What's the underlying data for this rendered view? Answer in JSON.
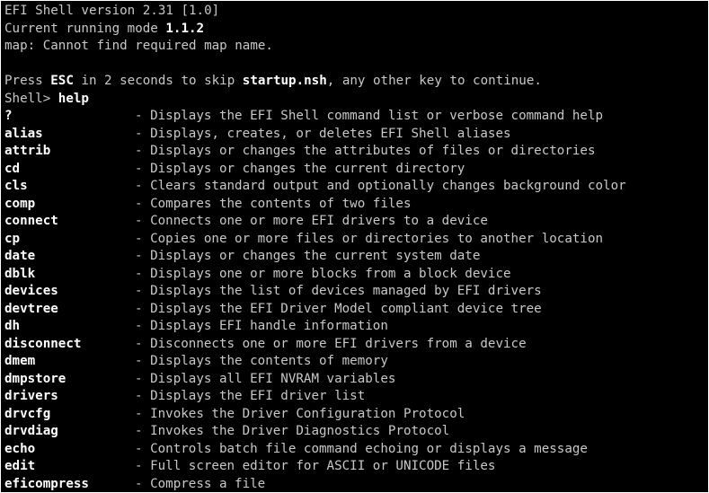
{
  "header": {
    "version_line": "EFI Shell version 2.31 [1.0]",
    "mode_prefix": "Current running mode ",
    "mode_value": "1.1.2",
    "map_line": "map: Cannot find required map name."
  },
  "startup": {
    "press": "Press ",
    "key": "ESC",
    "middle": " in 2 seconds to skip ",
    "file": "startup.nsh",
    "end": ", any other key to continue."
  },
  "prompt": {
    "label": "Shell> ",
    "command": "help"
  },
  "commands": [
    {
      "name": "?",
      "desc": "- Displays the EFI Shell command list or verbose command help"
    },
    {
      "name": "alias",
      "desc": "- Displays, creates, or deletes EFI Shell aliases"
    },
    {
      "name": "attrib",
      "desc": "- Displays or changes the attributes of files or directories"
    },
    {
      "name": "cd",
      "desc": "- Displays or changes the current directory"
    },
    {
      "name": "cls",
      "desc": "- Clears standard output and optionally changes background color"
    },
    {
      "name": "comp",
      "desc": "- Compares the contents of two files"
    },
    {
      "name": "connect",
      "desc": "- Connects one or more EFI drivers to a device"
    },
    {
      "name": "cp",
      "desc": "- Copies one or more files or directories to another location"
    },
    {
      "name": "date",
      "desc": "- Displays or changes the current system date"
    },
    {
      "name": "dblk",
      "desc": "- Displays one or more blocks from a block device"
    },
    {
      "name": "devices",
      "desc": "- Displays the list of devices managed by EFI drivers"
    },
    {
      "name": "devtree",
      "desc": "- Displays the EFI Driver Model compliant device tree"
    },
    {
      "name": "dh",
      "desc": "- Displays EFI handle information"
    },
    {
      "name": "disconnect",
      "desc": "- Disconnects one or more EFI drivers from a device"
    },
    {
      "name": "dmem",
      "desc": "- Displays the contents of memory"
    },
    {
      "name": "dmpstore",
      "desc": "- Displays all EFI NVRAM variables"
    },
    {
      "name": "drivers",
      "desc": "- Displays the EFI driver list"
    },
    {
      "name": "drvcfg",
      "desc": "- Invokes the Driver Configuration Protocol"
    },
    {
      "name": "drvdiag",
      "desc": "- Invokes the Driver Diagnostics Protocol"
    },
    {
      "name": "echo",
      "desc": "- Controls batch file command echoing or displays a message"
    },
    {
      "name": "edit",
      "desc": "- Full screen editor for ASCII or UNICODE files"
    },
    {
      "name": "eficompress",
      "desc": "- Compress a file"
    }
  ]
}
